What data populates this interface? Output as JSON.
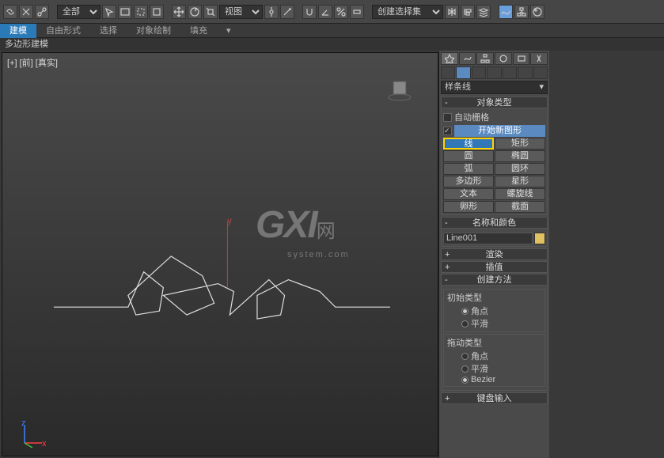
{
  "toolbar": {
    "filter_select": "全部",
    "view_select": "视图",
    "create_select": "创建选择集"
  },
  "ribbon": {
    "tabs": [
      "建模",
      "自由形式",
      "选择",
      "对象绘制",
      "填充"
    ],
    "subbar": "多边形建模"
  },
  "viewport": {
    "label": "[+] [前] [真实]"
  },
  "watermark": {
    "big": "GXI",
    "net": "网",
    "sub": "system.com"
  },
  "panel": {
    "shape_dropdown": "样条线",
    "rollouts": {
      "object_type": "对象类型",
      "auto_grid": "自动栅格",
      "start_new": "开始新图形",
      "name_color": "名称和颜色",
      "render": "渲染",
      "interp": "插值",
      "create_method": "创建方法",
      "initial_type": "初始类型",
      "drag_type": "拖动类型",
      "kb_entry": "键盘输入"
    },
    "shapes": {
      "line": "线",
      "rect": "矩形",
      "circle": "圆",
      "ellipse": "椭圆",
      "arc": "弧",
      "donut": "圆环",
      "ngon": "多边形",
      "star": "星形",
      "text": "文本",
      "helix": "螺旋线",
      "egg": "卵形",
      "section": "截面"
    },
    "object_name": "Line001",
    "radios": {
      "corner": "角点",
      "smooth": "平滑",
      "bezier": "Bezier"
    }
  }
}
